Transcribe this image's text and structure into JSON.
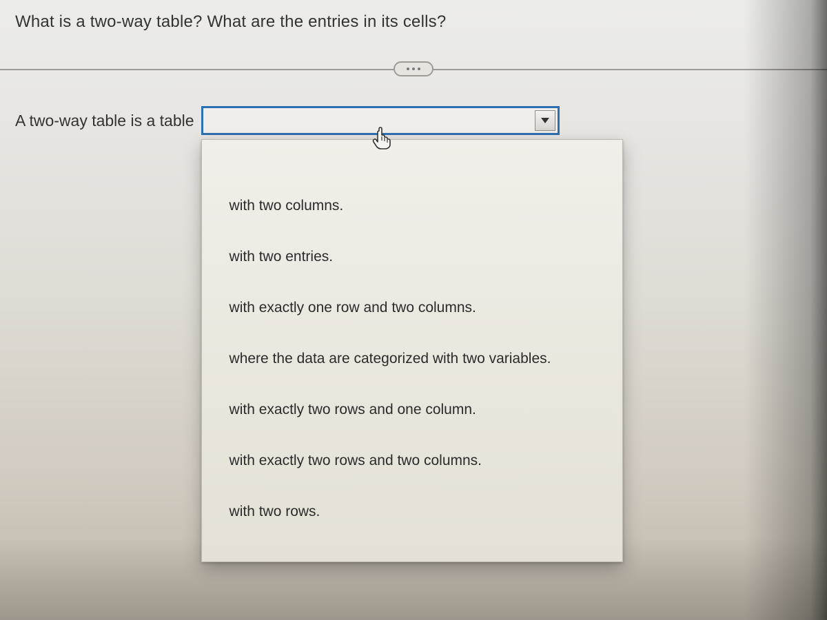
{
  "question": "What is a two-way table? What are the entries in its cells?",
  "prompt": "A two-way table is a table",
  "dropdown": {
    "selected": "",
    "options": [
      "with two columns.",
      "with two entries.",
      "with exactly one row and two columns.",
      "where the data are categorized with two variables.",
      "with exactly two rows and one column.",
      "with exactly two rows and two columns.",
      "with two rows."
    ]
  },
  "icons": {
    "more": "more-icon",
    "dropdown_arrow": "chevron-down-icon",
    "cursor": "pointer-hand-icon"
  },
  "colors": {
    "focus_border": "#2d6fb3",
    "text": "#2f2f2f"
  }
}
